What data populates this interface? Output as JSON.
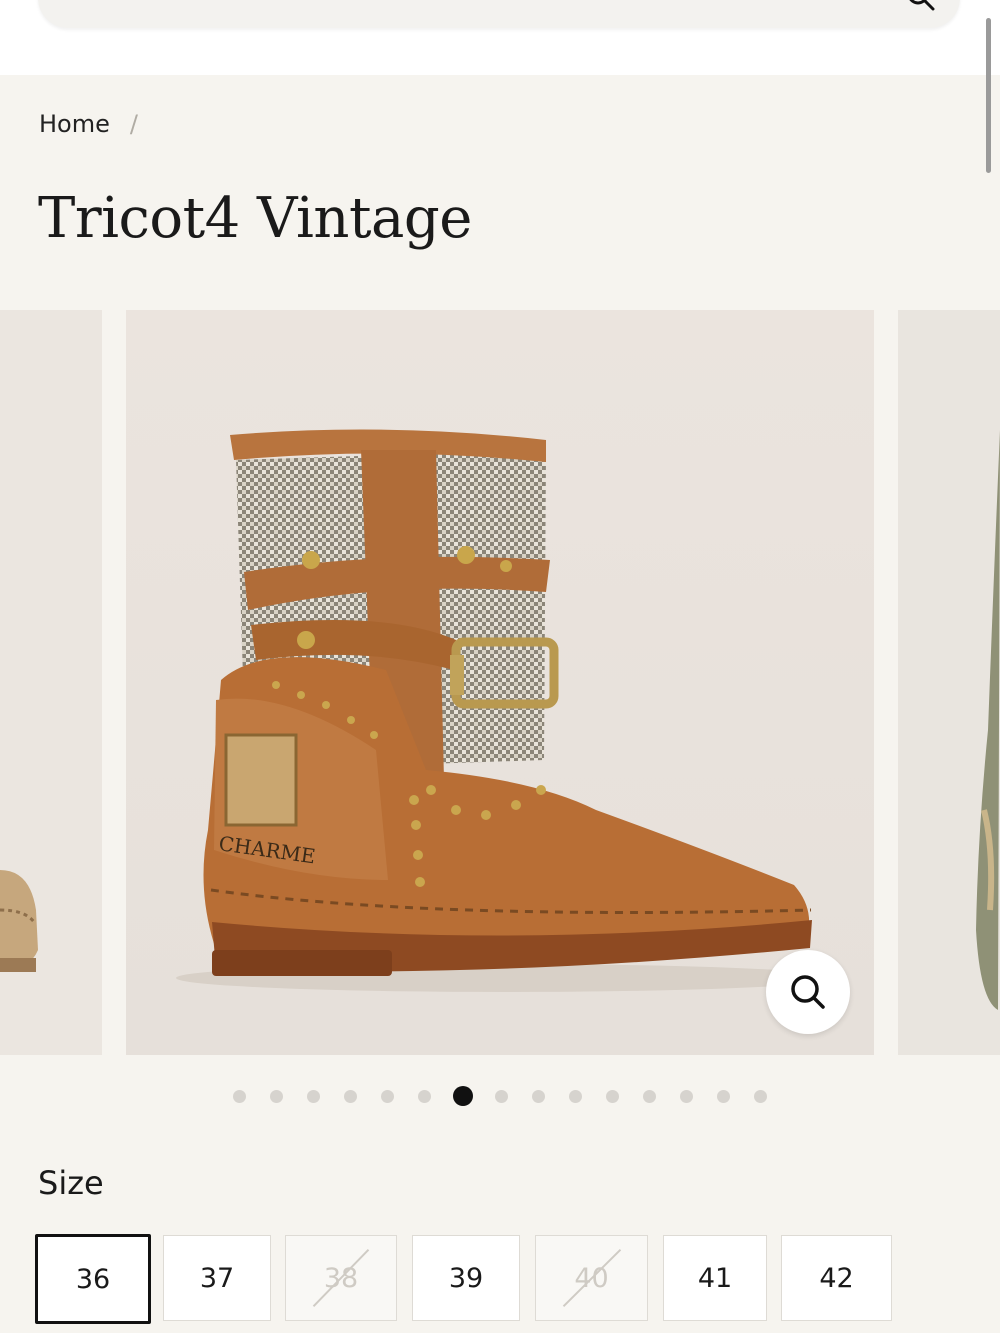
{
  "header": {
    "search_icon": "search-icon"
  },
  "breadcrumb": {
    "home": "Home",
    "separator": "/"
  },
  "product": {
    "title": "Tricot4 Vintage"
  },
  "gallery": {
    "slide_count": 15,
    "active_index": 6,
    "main_image": {
      "alt_text_visible": "CHARME"
    },
    "zoom_icon": "search-icon"
  },
  "size_selector": {
    "label": "Size",
    "options": [
      {
        "label": "36",
        "selected": true,
        "available": true
      },
      {
        "label": "37",
        "selected": false,
        "available": true
      },
      {
        "label": "38",
        "selected": false,
        "available": false
      },
      {
        "label": "39",
        "selected": false,
        "available": true
      },
      {
        "label": "40",
        "selected": false,
        "available": false
      },
      {
        "label": "41",
        "selected": false,
        "available": true
      },
      {
        "label": "42",
        "selected": false,
        "available": true
      }
    ]
  },
  "colors": {
    "background": "#f6f4ef",
    "text": "#1a1a1a",
    "active_dot": "#111111",
    "boot_leather": "#b86e35"
  }
}
